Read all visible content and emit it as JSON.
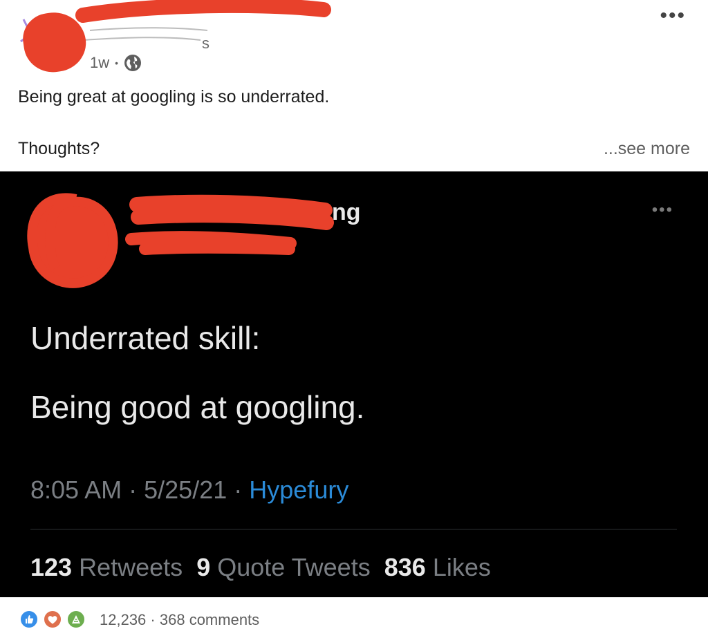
{
  "post": {
    "time": "1w",
    "visibility_separator": "•",
    "text_line1": "Being great at googling is so underrated.",
    "text_line2": "Thoughts?",
    "see_more": "...see more",
    "more_icon": "more-horizontal-icon"
  },
  "tweet": {
    "line1": "Underrated skill:",
    "line2": "Being good at googling.",
    "handle_partial": "ng",
    "time": "8:05 AM",
    "date": "5/25/21",
    "sep": "·",
    "source": "Hypefury",
    "retweets_count": "123",
    "retweets_label": "Retweets",
    "quotes_count": "9",
    "quotes_label": "Quote Tweets",
    "likes_count": "836",
    "likes_label": "Likes"
  },
  "reactions": {
    "icons": [
      "like-icon",
      "love-icon",
      "celebrate-icon"
    ],
    "count": "12,236",
    "sep": "·",
    "comments": "368 comments"
  },
  "colors": {
    "redaction": "#e8412b",
    "linkedin_blue": "#378fe9",
    "twitter_blue": "#2b8bd8"
  }
}
